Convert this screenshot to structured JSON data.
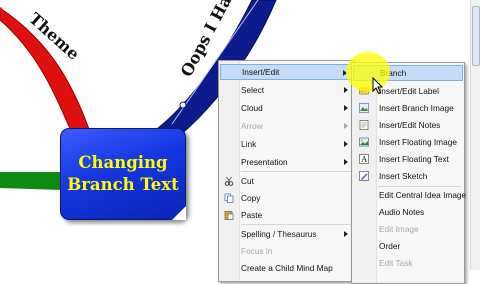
{
  "mind_map": {
    "central_idea": {
      "line1": "Changing",
      "line2": "Branch Text"
    },
    "branches": [
      {
        "label": "Theme"
      },
      {
        "label": "Oops I Ha"
      }
    ]
  },
  "context_menu": {
    "items": [
      {
        "label": "Insert/Edit",
        "submenu": true,
        "highlighted": true
      },
      {
        "label": "Select",
        "submenu": true
      },
      {
        "label": "Cloud",
        "submenu": true
      },
      {
        "label": "Arrow",
        "submenu": true,
        "disabled": true
      },
      {
        "label": "Link",
        "submenu": true
      },
      {
        "label": "Presentation",
        "submenu": true
      },
      {
        "label": "Cut",
        "icon": "scissors-icon"
      },
      {
        "label": "Copy",
        "icon": "copy-icon"
      },
      {
        "label": "Paste",
        "icon": "paste-icon"
      },
      {
        "label": "Spelling / Thesaurus",
        "submenu": true
      },
      {
        "label": "Focus in",
        "disabled": true
      },
      {
        "label": "Create a Child Mind Map"
      }
    ]
  },
  "submenu": {
    "items": [
      {
        "label": "Branch",
        "highlighted": true
      },
      {
        "label": "Insert/Edit Label",
        "icon": "label-icon"
      },
      {
        "label": "Insert Branch Image",
        "icon": "branch-image-icon"
      },
      {
        "label": "Insert/Edit Notes",
        "icon": "notes-icon"
      },
      {
        "label": "Insert Floating Image",
        "icon": "floating-image-icon"
      },
      {
        "label": "Insert Floating Text",
        "icon": "floating-text-icon"
      },
      {
        "label": "Insert Sketch",
        "icon": "sketch-icon"
      },
      {
        "label": "Edit Central Idea Image"
      },
      {
        "label": "Audio Notes"
      },
      {
        "label": "Edit Image",
        "disabled": true
      },
      {
        "label": "Order"
      },
      {
        "label": "Edit Task",
        "disabled": true
      }
    ]
  },
  "colors": {
    "theme_branch": "#e01010",
    "oops_branch": "#0c1c8c",
    "green_branch": "#0e8a14",
    "central_fill": "#1536e0",
    "central_text": "#ffff00",
    "menu_highlight": "#c5dcf8",
    "spotlight": "#ffff00"
  }
}
